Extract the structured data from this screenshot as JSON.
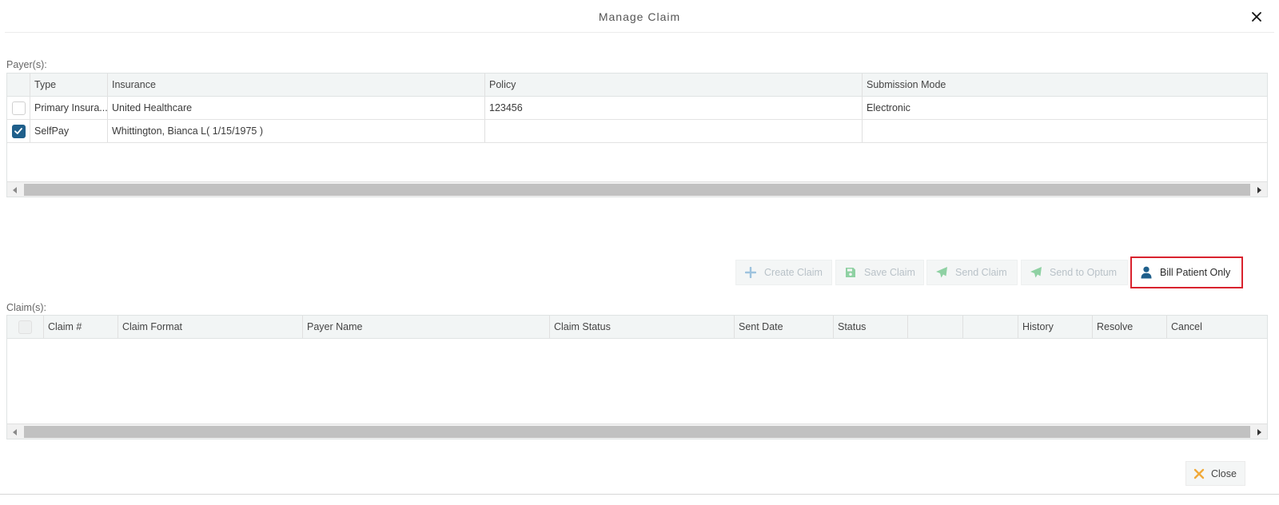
{
  "modal": {
    "title": "Manage Claim"
  },
  "payers": {
    "label": "Payer(s):",
    "columns": [
      "Type",
      "Insurance",
      "Policy",
      "Submission Mode"
    ],
    "rows": [
      {
        "checked": false,
        "type": "Primary Insura...",
        "insurance": "United Healthcare",
        "policy": "123456",
        "submission_mode": "Electronic"
      },
      {
        "checked": true,
        "type": "SelfPay",
        "insurance": "Whittington, Bianca L( 1/15/1975 )",
        "policy": "",
        "submission_mode": ""
      }
    ]
  },
  "toolbar": {
    "create_claim": "Create Claim",
    "save_claim": "Save Claim",
    "send_claim": "Send Claim",
    "send_to_optum": "Send to Optum",
    "bill_patient_only": "Bill Patient Only"
  },
  "claims": {
    "label": "Claim(s):",
    "columns": [
      "Claim #",
      "Claim Format",
      "Payer Name",
      "Claim Status",
      "Sent Date",
      "Status",
      "",
      "",
      "History",
      "Resolve",
      "Cancel"
    ]
  },
  "footer": {
    "close_label": "Close"
  },
  "icons": {
    "close": "close-icon",
    "plus": "plus-icon",
    "save": "floppy-disk-icon",
    "send": "paper-plane-icon",
    "user": "user-icon",
    "checkmark": "checkmark-icon",
    "left_arrow": "caret-left-icon",
    "right_arrow": "caret-right-icon"
  },
  "colors": {
    "accent": "#1f5f8b",
    "highlight_border": "#d9232e",
    "disabled_text": "#b9c2c8",
    "disabled_send_icon": "#8fd1a3",
    "close_icon": "#f0a93a"
  }
}
